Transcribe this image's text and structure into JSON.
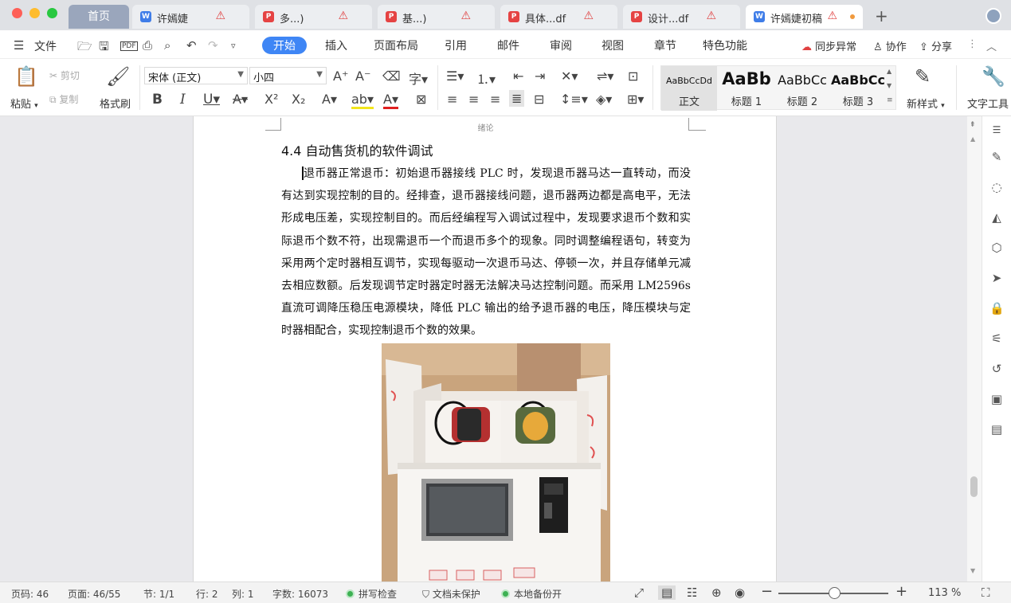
{
  "tabs": {
    "home": "首页",
    "docs": [
      {
        "label": "许嫣婕",
        "type": "word",
        "warn": "⚠"
      },
      {
        "label": "多...)",
        "type": "pdf",
        "warn": "⚠"
      },
      {
        "label": "基...)",
        "type": "pdf",
        "warn": "⚠"
      },
      {
        "label": "具体...df",
        "type": "pdf",
        "warn": "⚠"
      },
      {
        "label": "设计...df",
        "type": "pdf",
        "warn": "⚠"
      },
      {
        "label": "许嫣婕初稿",
        "type": "word",
        "warn": "⚠"
      }
    ],
    "new_tab": "+"
  },
  "menu": {
    "file": "文件",
    "tabs": [
      "开始",
      "插入",
      "页面布局",
      "引用",
      "邮件",
      "审阅",
      "视图",
      "章节",
      "特色功能"
    ],
    "sync": "同步异常",
    "collab": "协作",
    "share": "分享"
  },
  "ribbon": {
    "paste": "粘贴",
    "cut": "剪切",
    "copy": "复制",
    "format_painter": "格式刷",
    "font_name": "宋体 (正文)",
    "font_size": "小四",
    "new_style": "新样式",
    "text_tool": "文字工具",
    "styles": [
      {
        "sample": "AaBbCcDd",
        "name": "正文"
      },
      {
        "sample": "AaBb",
        "name": "标题 1"
      },
      {
        "sample": "AaBbCc",
        "name": "标题 2"
      },
      {
        "sample": "AaBbCc",
        "name": "标题 3"
      }
    ]
  },
  "document": {
    "header": "绪论",
    "heading": "4.4 自动售货机的软件调试",
    "paragraph": "退币器正常退币：初始退币器接线 PLC 时，发现退币器马达一直转动，而没有达到实现控制的目的。经排查，退币器接线问题，退币器两边都是高电平，无法形成电压差，实现控制目的。而后经编程写入调试过程中，发现要求退币个数和实际退币个数不符，出现需退币一个而退币多个的现象。同时调整编程语句，转变为采用两个定时器相互调节，实现每驱动一次退币马达、停顿一次，并且存储单元减去相应数额。后发现调节定时器定时器无法解决马达控制问题。而采用 LM2596s 直流可调降压稳压电源模块，降低 PLC 输出的给予退币器的电压，降压模块与定时器相配合，实现控制退币个数的效果。"
  },
  "status": {
    "page_code": "页码: 46",
    "page": "页面: 46/55",
    "section": "节: 1/1",
    "row": "行: 2",
    "col": "列: 1",
    "word_count": "字数: 16073",
    "spell_check": "拼写检查",
    "doc_protect": "文档未保护",
    "backup": "本地备份开",
    "zoom": "113 %"
  },
  "colors": {
    "accent": "#3f86f5",
    "warn": "#e04040",
    "pdf_icon": "#e54343",
    "word_icon": "#3f7de8",
    "status_ok": "#3db153"
  }
}
